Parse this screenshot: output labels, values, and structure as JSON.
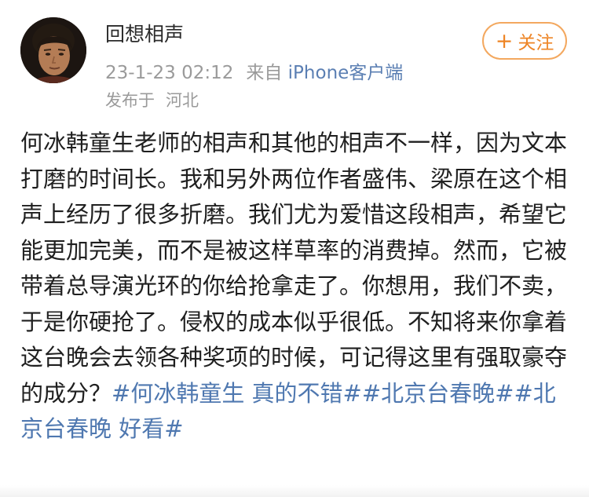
{
  "post": {
    "author": {
      "name": "回想相声",
      "avatar_icon": "user-avatar-photo"
    },
    "timestamp": "23-1-23 02:12",
    "source_prefix": "来自",
    "source_client": "iPhone客户端",
    "location_label": "发布于",
    "location_value": "河北",
    "follow_button": {
      "icon": "+",
      "label": "关注"
    },
    "body_text": "何冰韩童生老师的相声和其他的相声不一样，因为文本打磨的时间长。我和另外两位作者盛伟、梁原在这个相声上经历了很多折磨。我们尤为爱惜这段相声，希望它能更加完美，而不是被这样草率的消费掉。然而，它被带着总导演光环的你给抢拿走了。你想用，我们不卖，于是你硬抢了。侵权的成本似乎很低。不知将来你拿着这台晚会去领各种奖项的时候，可记得这里有强取豪夺的成分？",
    "hashtags": [
      "#何冰韩童生 真的不错#",
      "#北京台春晚#",
      "#北京台春晚 好看#"
    ]
  },
  "colors": {
    "link": "#4f78b0",
    "client_link": "#5b7fb3",
    "follow_accent": "#ee8526",
    "meta_gray": "#9a9a9a",
    "text": "#1f1f1f"
  }
}
